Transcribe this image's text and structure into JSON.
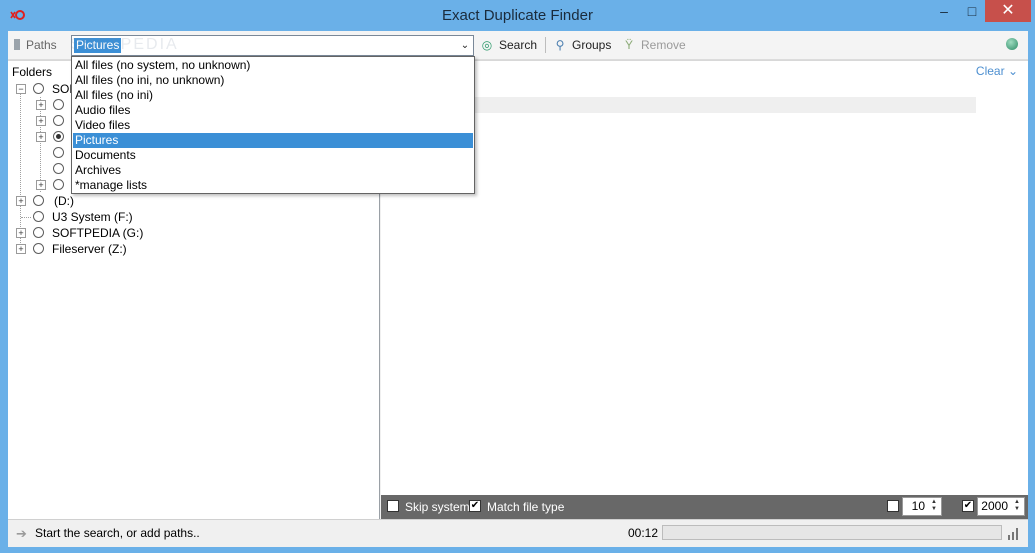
{
  "window": {
    "title": "Exact Duplicate Finder",
    "controls": {
      "minimize": "–",
      "maximize": "□",
      "close": "✕"
    }
  },
  "toolbar": {
    "paths_label": "Paths",
    "filter_value": "Pictures",
    "search_label": "Search",
    "groups_label": "Groups",
    "remove_label": "Remove"
  },
  "filter_options": [
    "All files (no system, no unknown)",
    "All files (no ini, no unknown)",
    "All files (no ini)",
    "Audio files",
    "Video files",
    "Pictures",
    "Documents",
    "Archives",
    "*manage lists"
  ],
  "filter_selected_index": 5,
  "folders": {
    "label": "Folders",
    "root_label": "SOF",
    "drives": [
      "(D:)",
      "U3 System (F:)",
      "SOFTPEDIA (G:)",
      "Fileserver (Z:)"
    ]
  },
  "results": {
    "clear_label": "Clear"
  },
  "options": {
    "skip_system_label": "Skip system",
    "skip_system_checked": false,
    "match_file_type_label": "Match file type",
    "match_file_type_checked": true,
    "min_value": "10",
    "min_checked": false,
    "max_value": "2000",
    "max_checked": true
  },
  "status": {
    "message": "Start the search, or add paths..",
    "elapsed": "00:12",
    "progress_fraction": 0
  },
  "watermark": "SOFTPEDIA"
}
